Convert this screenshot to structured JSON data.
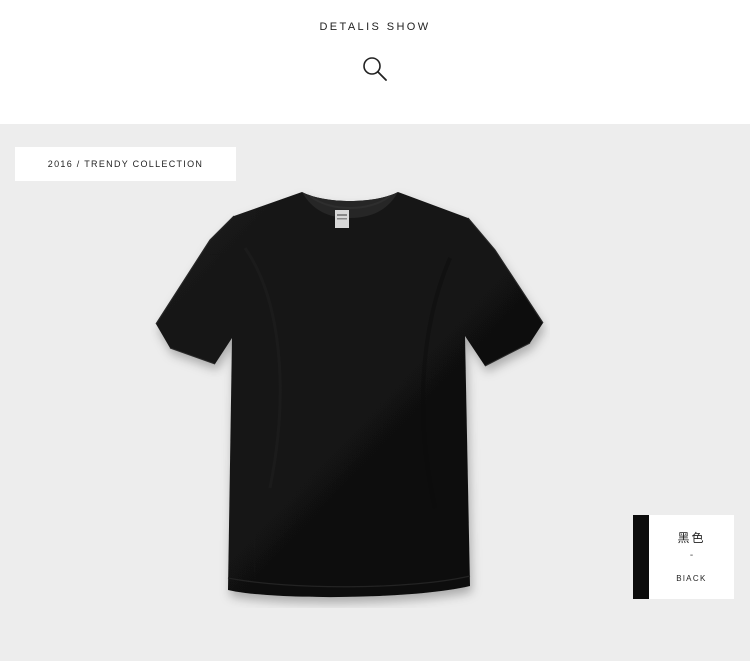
{
  "header": {
    "title": "DETALIS SHOW",
    "icon": "search-icon"
  },
  "collection_tag": {
    "text": "2016 / TRENDY COLLECTION"
  },
  "product": {
    "image": "black-tshirt",
    "color": "#141414"
  },
  "swatch": {
    "name_cn": "黑色",
    "separator": "-",
    "name_en": "BlACK",
    "color": "#0c0c0c"
  },
  "colors": {
    "background": "#ededed",
    "card": "#ffffff",
    "text": "#222222"
  }
}
